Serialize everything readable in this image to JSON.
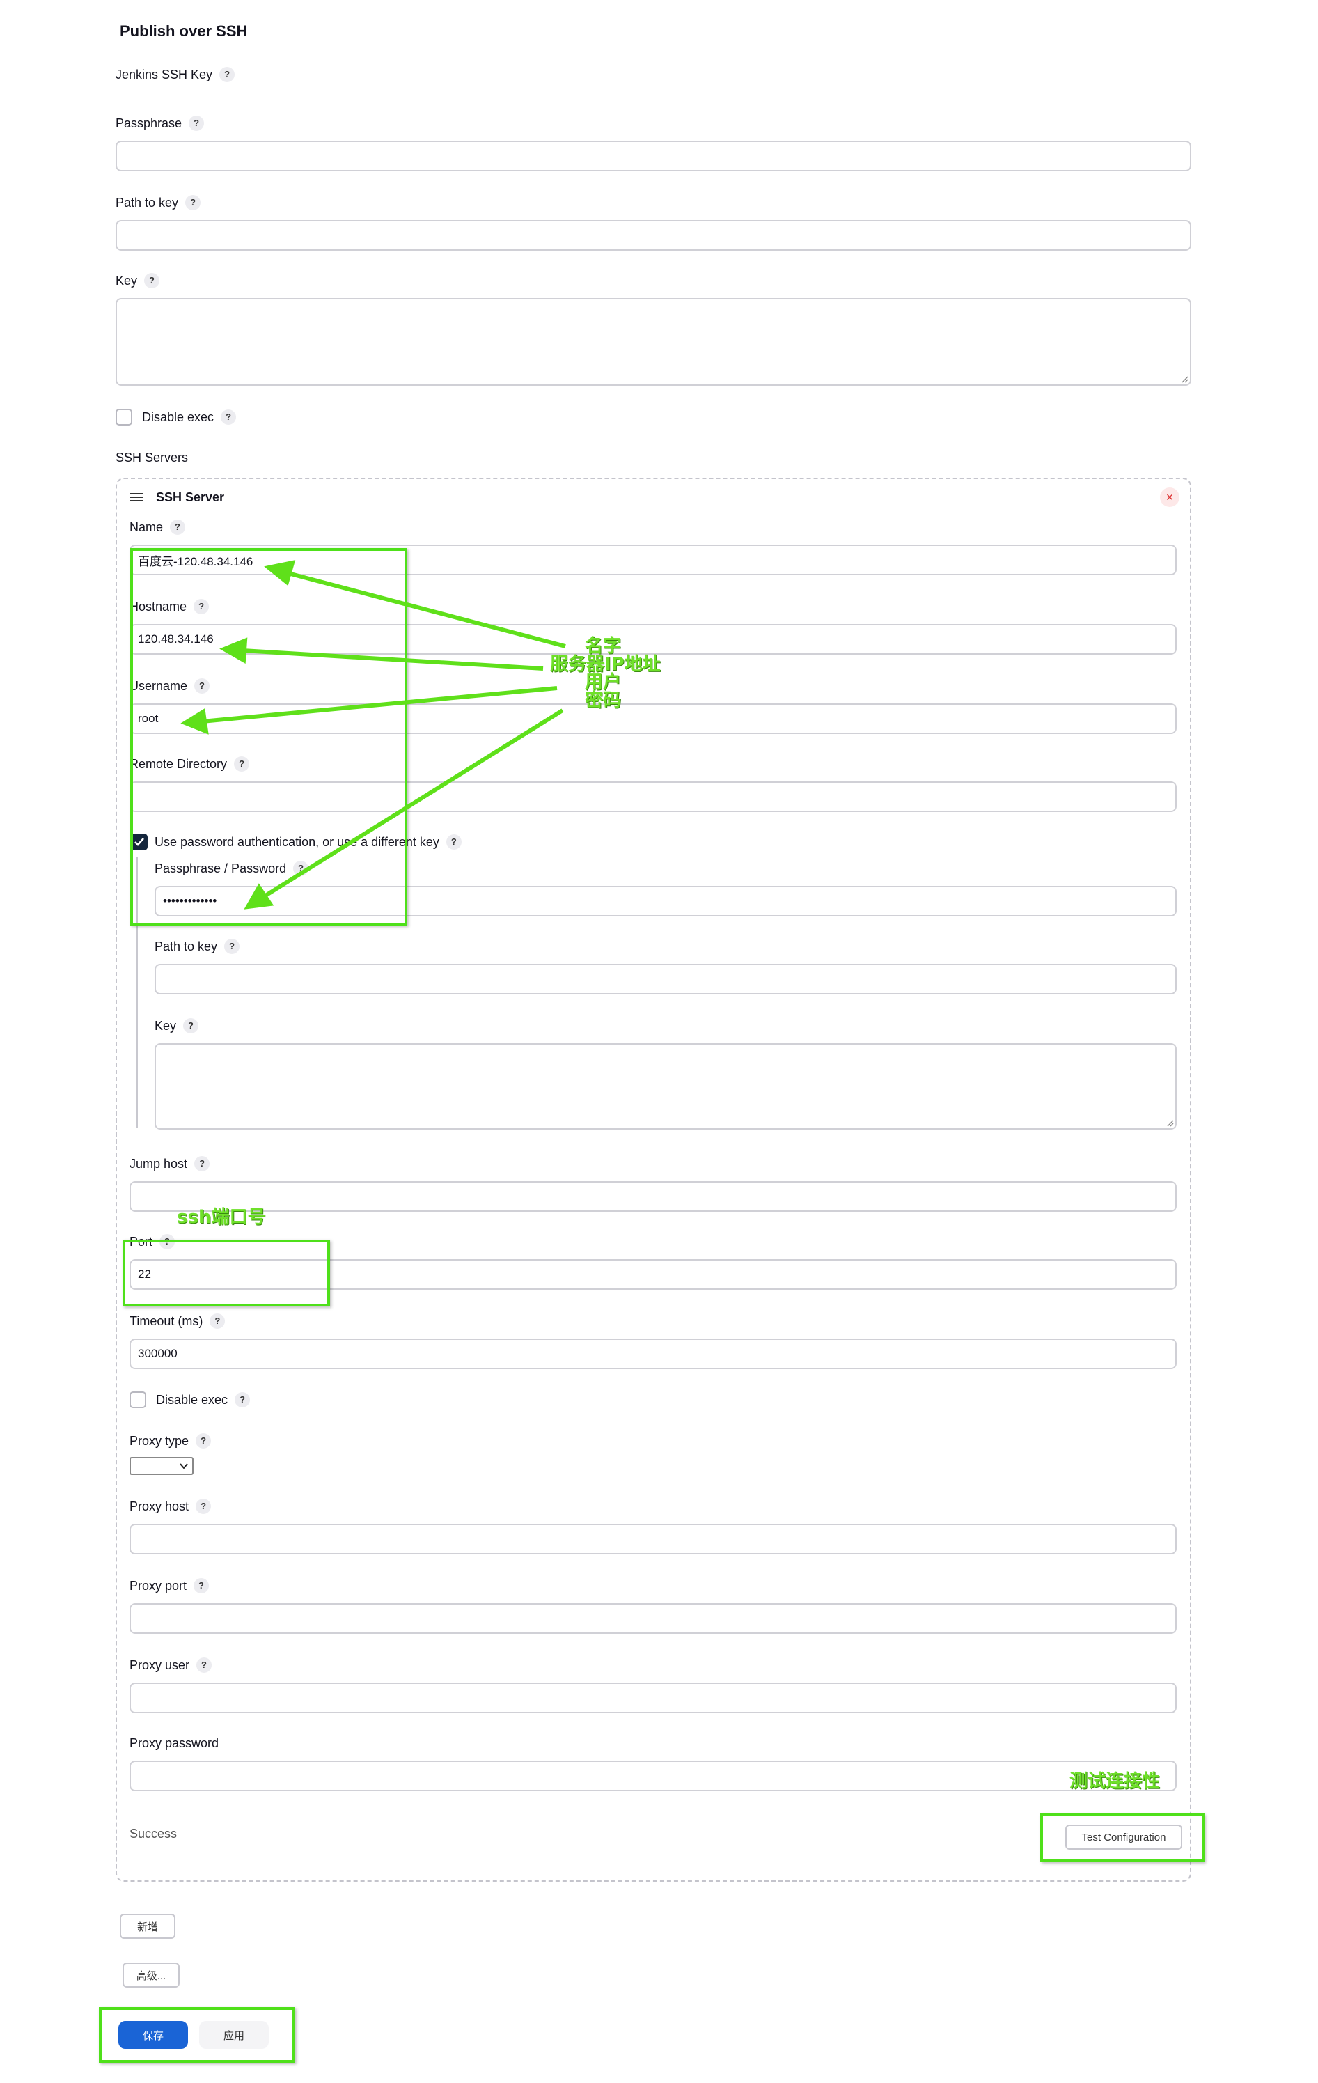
{
  "section_title": "Publish over SSH",
  "global": {
    "jenkins_ssh_key_label": "Jenkins SSH Key",
    "passphrase_label": "Passphrase",
    "path_to_key_label": "Path to key",
    "key_label": "Key",
    "disable_exec_label": "Disable exec",
    "ssh_servers_label": "SSH Servers",
    "passphrase_value": "",
    "path_to_key_value": "",
    "key_value": ""
  },
  "server": {
    "header": "SSH Server",
    "name_label": "Name",
    "name_value": "百度云-120.48.34.146",
    "hostname_label": "Hostname",
    "hostname_value": "120.48.34.146",
    "username_label": "Username",
    "username_value": "root",
    "remote_dir_label": "Remote Directory",
    "remote_dir_value": "",
    "use_password_label": "Use password authentication, or use a different key",
    "use_password_checked": true,
    "passphrase_password_label": "Passphrase / Password",
    "passphrase_password_value": "•••••••••••••",
    "path_to_key_label": "Path to key",
    "key_label": "Key",
    "jump_host_label": "Jump host",
    "port_label": "Port",
    "port_value": "22",
    "timeout_label": "Timeout (ms)",
    "timeout_value": "300000",
    "disable_exec_label": "Disable exec",
    "proxy_type_label": "Proxy type",
    "proxy_type_value": "",
    "proxy_host_label": "Proxy host",
    "proxy_port_label": "Proxy port",
    "proxy_user_label": "Proxy user",
    "proxy_password_label": "Proxy password",
    "status_text": "Success",
    "test_button": "Test Configuration"
  },
  "buttons": {
    "add": "新增",
    "advanced": "高级...",
    "save": "保存",
    "apply": "应用"
  },
  "annotations": {
    "name": "名字",
    "server_ip": "服务器IP地址",
    "user": "用户",
    "password": "密码",
    "ssh_port": "ssh端口号",
    "test_connectivity": "测试连接性"
  },
  "help_glyph": "?",
  "colors": {
    "accent_green": "#4fe01a",
    "save_blue": "#1a64d6",
    "checkbox_dark": "#14263c"
  }
}
